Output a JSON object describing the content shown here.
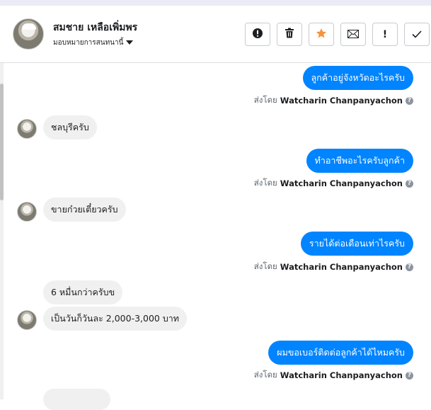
{
  "contact": {
    "name": "สมชาย เหลือเพิ่มพร",
    "assign_label": "มอบหมายการสนทนานี้"
  },
  "actions": [
    {
      "icon": "exclamation-circle-icon",
      "label": ""
    },
    {
      "icon": "trash-icon",
      "label": ""
    },
    {
      "icon": "star-icon",
      "label": ""
    },
    {
      "icon": "envelope-icon",
      "label": ""
    },
    {
      "icon": "exclamation-icon",
      "label": "!"
    },
    {
      "icon": "check-icon",
      "label": ""
    }
  ],
  "colors": {
    "outgoing": "#0084ff",
    "incoming": "#f0f0f0",
    "star": "#f7923b"
  },
  "sent_by_label": "ส่งโดย",
  "sender_name": "Watcharin Chanpanyachon",
  "messages": [
    {
      "direction": "out",
      "text": "ลูกค้าอยู่จังหวัดอะไรครับ"
    },
    {
      "direction": "in",
      "text": "ชลบุรีครับ"
    },
    {
      "direction": "out",
      "text": "ทำอาชีพอะไรครับลูกค้า"
    },
    {
      "direction": "in",
      "text": "ขายก๋วยเตี๋ยวครับ"
    },
    {
      "direction": "out",
      "text": "รายได้ต่อเดือนเท่าไรครับ"
    },
    {
      "direction": "in",
      "text": "6 หมื่นกว่าครับข"
    },
    {
      "direction": "in",
      "text": "เป็นวันก็วันละ 2,000-3,000 บาท"
    },
    {
      "direction": "out",
      "text": "ผมขอเบอร์ติดต่อลูกค้าได้ไหมครับ"
    }
  ]
}
